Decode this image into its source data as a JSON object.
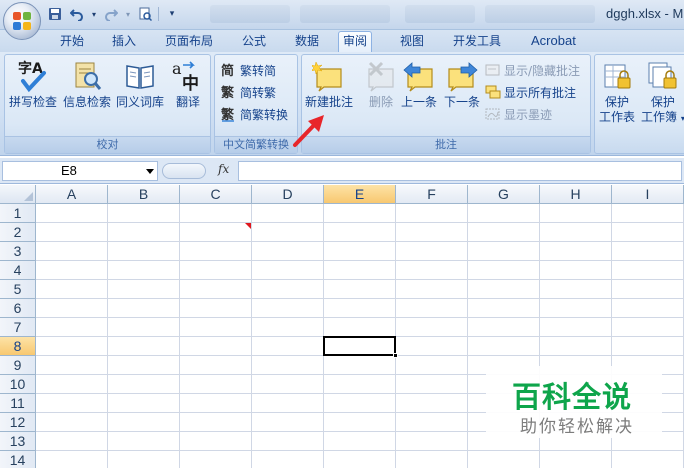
{
  "window": {
    "title": "dggh.xlsx - M"
  },
  "quick_access": {
    "icons": [
      "save-icon",
      "undo-icon",
      "redo-icon",
      "print-preview-icon",
      "customize-icon"
    ]
  },
  "tabs": [
    {
      "label": "开始"
    },
    {
      "label": "插入"
    },
    {
      "label": "页面布局"
    },
    {
      "label": "公式"
    },
    {
      "label": "数据"
    },
    {
      "label": "审阅",
      "active": true
    },
    {
      "label": "视图"
    },
    {
      "label": "开发工具"
    },
    {
      "label": "Acrobat"
    }
  ],
  "ribbon": {
    "proofing": {
      "label": "校对",
      "buttons": [
        {
          "label": "拼写检查"
        },
        {
          "label": "信息检索"
        },
        {
          "label": "同义词库"
        },
        {
          "label": "翻译"
        }
      ]
    },
    "chinese": {
      "label": "中文简繁转换",
      "buttons": [
        {
          "label": "繁转简"
        },
        {
          "label": "简转繁"
        },
        {
          "label": "简繁转换"
        }
      ]
    },
    "comments": {
      "label": "批注",
      "buttons": [
        {
          "label": "新建批注"
        },
        {
          "label": "删除"
        },
        {
          "label": "上一条"
        },
        {
          "label": "下一条"
        },
        {
          "label": "显示/隐藏批注"
        },
        {
          "label": "显示所有批注"
        },
        {
          "label": "显示墨迹"
        }
      ]
    },
    "protect": {
      "buttons": [
        {
          "line1": "保护",
          "line2": "工作表"
        },
        {
          "line1": "保护",
          "line2": "工作簿"
        }
      ]
    }
  },
  "formula_bar": {
    "name_box": "E8",
    "fx": "fx",
    "formula": ""
  },
  "sheet": {
    "columns": [
      "A",
      "B",
      "C",
      "D",
      "E",
      "F",
      "G",
      "H",
      "I"
    ],
    "rows": [
      "1",
      "2",
      "3",
      "4",
      "5",
      "6",
      "7",
      "8",
      "9",
      "10",
      "11",
      "12",
      "13",
      "14"
    ],
    "selected_cell": "E8",
    "comment_cell": "C2"
  },
  "watermark": {
    "title": "百科全说",
    "subtitle": "助你轻松解决"
  },
  "colors": {
    "accent": "#15428b",
    "selected_header": "#f8c870",
    "annotation_arrow": "#e8262a",
    "watermark_green": "#0ea54b"
  }
}
